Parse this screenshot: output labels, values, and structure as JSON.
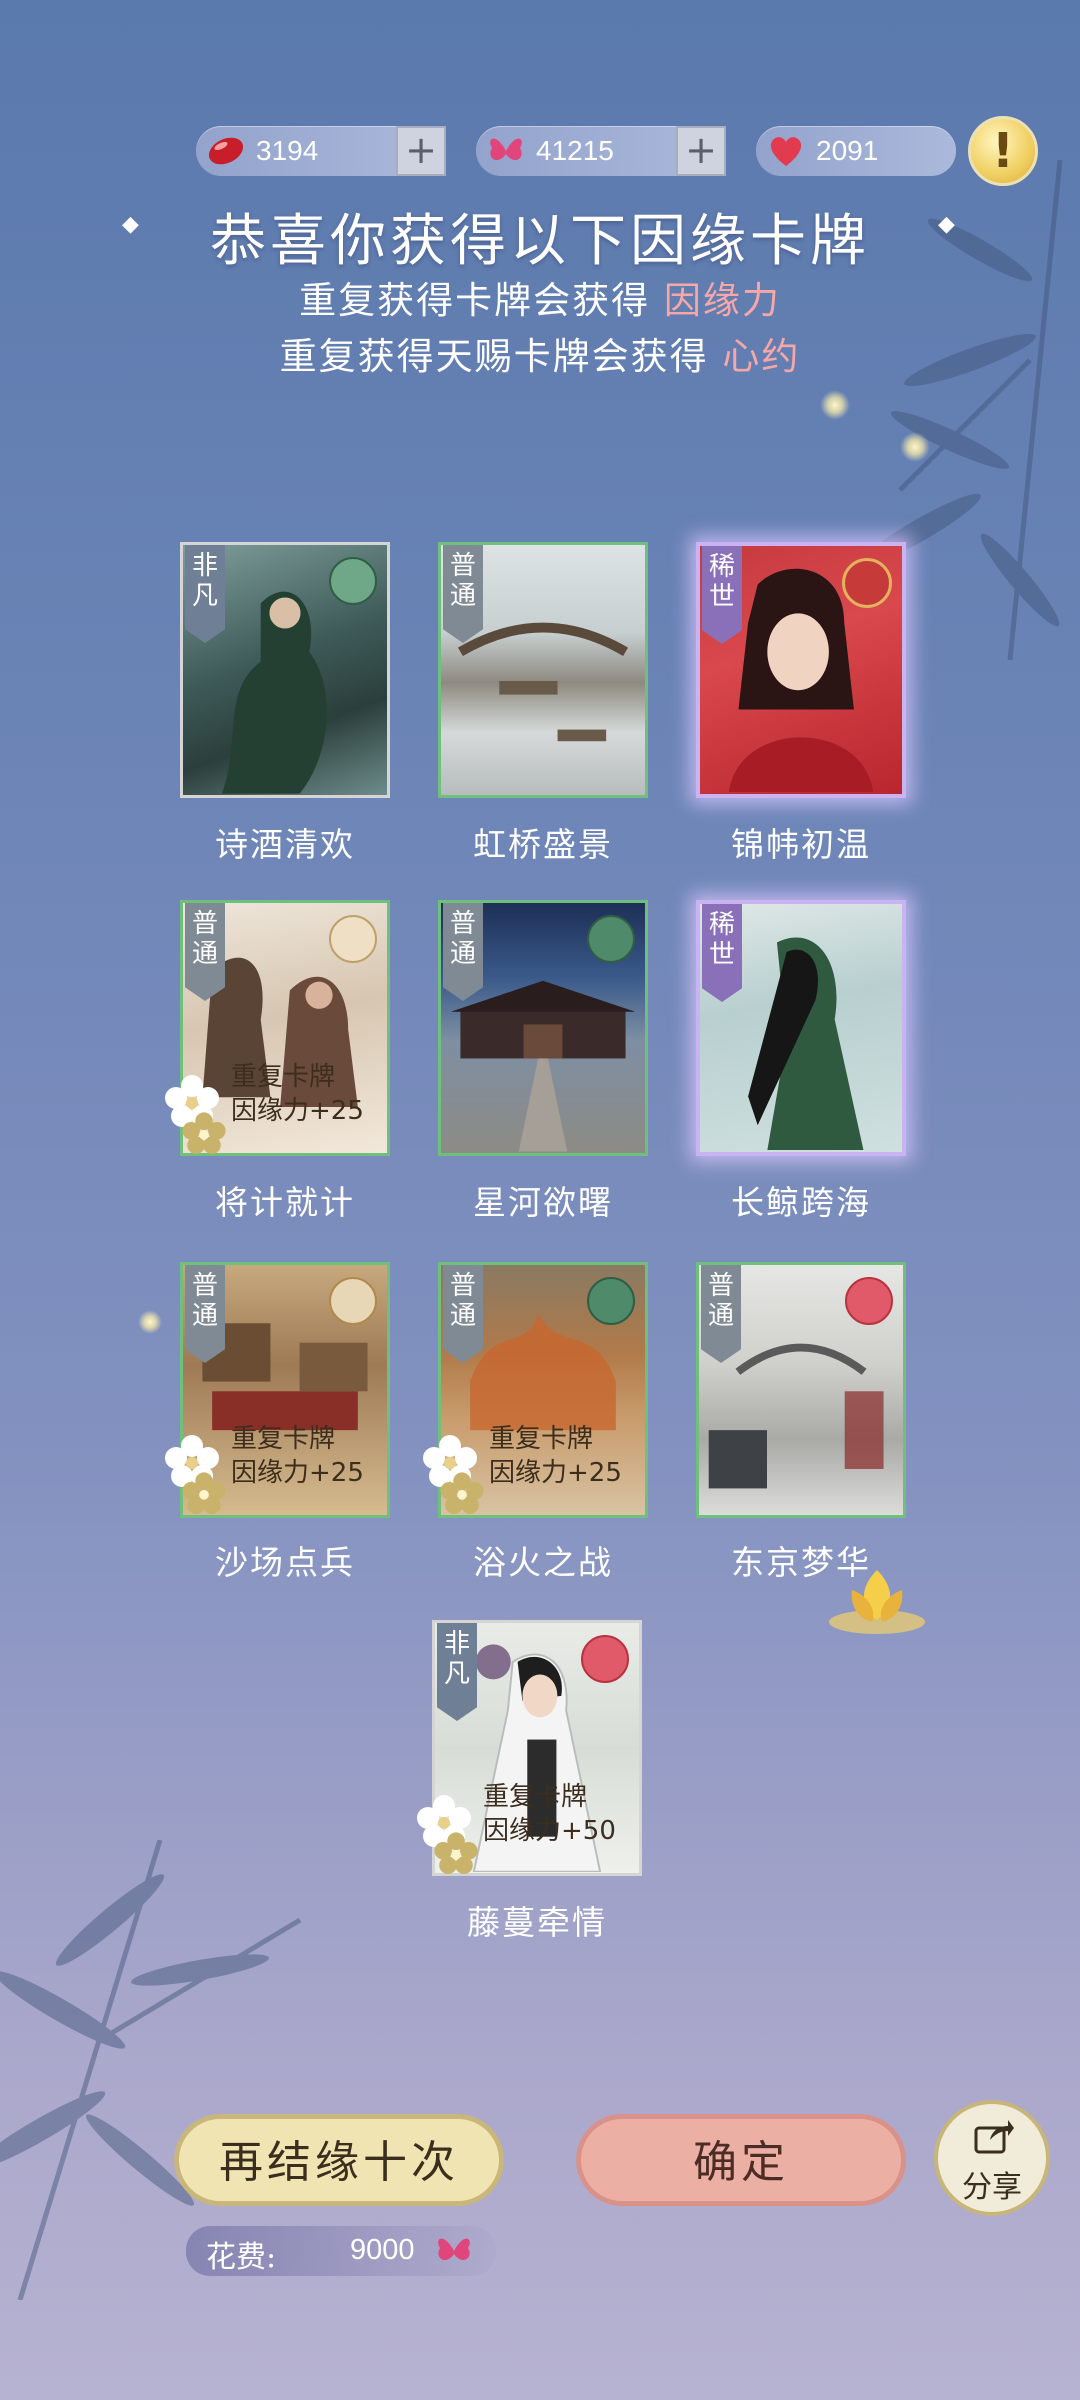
{
  "currency": [
    {
      "icon": "red-bean-icon",
      "value": "3194",
      "has_plus": true
    },
    {
      "icon": "butterfly-icon",
      "value": "41215",
      "has_plus": true
    },
    {
      "icon": "heart-icon",
      "value": "2091",
      "has_plus": false
    }
  ],
  "header": {
    "title": "恭喜你获得以下因缘卡牌",
    "line1_prefix": "重复获得卡牌会获得",
    "line1_highlight": "因缘力",
    "line2_prefix": "重复获得天赐卡牌会获得",
    "line2_highlight": "心约"
  },
  "cards": [
    {
      "name": "诗酒清欢",
      "rarity": "非凡",
      "dup": false
    },
    {
      "name": "虹桥盛景",
      "rarity": "普通",
      "dup": false
    },
    {
      "name": "锦帏初温",
      "rarity": "稀世",
      "dup": false
    },
    {
      "name": "将计就计",
      "rarity": "普通",
      "dup": true,
      "dup_title": "重复卡牌",
      "dup_reward": "因缘力+25"
    },
    {
      "name": "星河欲曙",
      "rarity": "普通",
      "dup": false
    },
    {
      "name": "长鲸跨海",
      "rarity": "稀世",
      "dup": false
    },
    {
      "name": "沙场点兵",
      "rarity": "普通",
      "dup": true,
      "dup_title": "重复卡牌",
      "dup_reward": "因缘力+25"
    },
    {
      "name": "浴火之战",
      "rarity": "普通",
      "dup": true,
      "dup_title": "重复卡牌",
      "dup_reward": "因缘力+25"
    },
    {
      "name": "东京梦华",
      "rarity": "普通",
      "dup": false
    },
    {
      "name": "藤蔓牵情",
      "rarity": "非凡",
      "dup": true,
      "dup_title": "重复卡牌",
      "dup_reward": "因缘力+50"
    }
  ],
  "buttons": {
    "again": "再结缘十次",
    "confirm": "确定",
    "share": "分享"
  },
  "cost": {
    "label": "花费:",
    "value": "9000"
  },
  "colors": {
    "accent_pink": "#f7a7a7",
    "common_border": "#6fbf7d",
    "rare_glow": "#c9b3f2"
  }
}
